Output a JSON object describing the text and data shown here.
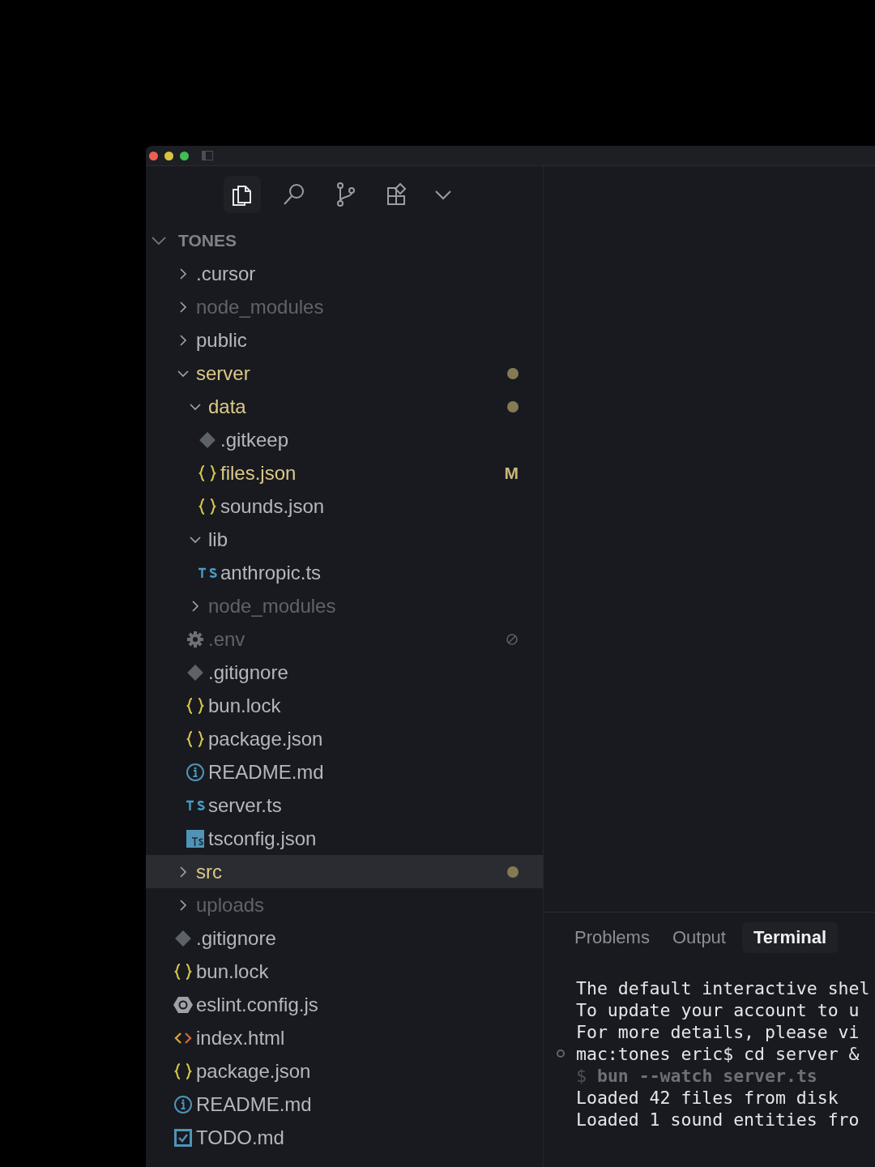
{
  "activity_tabs": [
    {
      "selected": true
    },
    {
      "selected": false
    },
    {
      "selected": false
    },
    {
      "selected": false
    }
  ],
  "explorer": {
    "title": "TONES",
    "expanded": true,
    "tree": [
      {
        "name": ".cursor",
        "kind": "folder",
        "expanded": false,
        "modified": false,
        "ignored": false,
        "selected": false
      },
      {
        "name": "node_modules",
        "kind": "folder",
        "expanded": false,
        "modified": false,
        "ignored": true,
        "selected": false
      },
      {
        "name": "public",
        "kind": "folder",
        "expanded": false,
        "modified": false,
        "ignored": false,
        "selected": false
      },
      {
        "name": "server",
        "kind": "folder",
        "expanded": true,
        "modified": true,
        "ignored": false,
        "selected": false,
        "children": [
          {
            "name": "data",
            "kind": "folder",
            "expanded": true,
            "modified": true,
            "ignored": false,
            "selected": false,
            "children": [
              {
                "name": ".gitkeep",
                "kind": "git",
                "modified": false,
                "ignored": false,
                "selected": false
              },
              {
                "name": "files.json",
                "kind": "json",
                "modified": true,
                "ignored": false,
                "badge": "M",
                "selected": false
              },
              {
                "name": "sounds.json",
                "kind": "json",
                "modified": false,
                "ignored": false,
                "selected": false
              }
            ]
          },
          {
            "name": "lib",
            "kind": "folder",
            "expanded": true,
            "modified": false,
            "ignored": false,
            "selected": false,
            "children": [
              {
                "name": "anthropic.ts",
                "kind": "ts",
                "modified": false,
                "ignored": false,
                "selected": false
              }
            ]
          },
          {
            "name": "node_modules",
            "kind": "folder",
            "expanded": false,
            "modified": false,
            "ignored": true,
            "selected": false
          },
          {
            "name": ".env",
            "kind": "gear",
            "modified": false,
            "ignored": true,
            "selected": false
          },
          {
            "name": ".gitignore",
            "kind": "git",
            "modified": false,
            "ignored": false,
            "selected": false
          },
          {
            "name": "bun.lock",
            "kind": "json",
            "modified": false,
            "ignored": false,
            "selected": false
          },
          {
            "name": "package.json",
            "kind": "json",
            "modified": false,
            "ignored": false,
            "selected": false
          },
          {
            "name": "README.md",
            "kind": "info",
            "modified": false,
            "ignored": false,
            "selected": false
          },
          {
            "name": "server.ts",
            "kind": "ts",
            "modified": false,
            "ignored": false,
            "selected": false
          },
          {
            "name": "tsconfig.json",
            "kind": "tsconfig",
            "modified": false,
            "ignored": false,
            "selected": false
          }
        ]
      },
      {
        "name": "src",
        "kind": "folder",
        "expanded": false,
        "modified": true,
        "ignored": false,
        "selected": true
      },
      {
        "name": "uploads",
        "kind": "folder",
        "expanded": false,
        "modified": false,
        "ignored": true,
        "selected": false
      },
      {
        "name": ".gitignore",
        "kind": "git",
        "modified": false,
        "ignored": false,
        "selected": false
      },
      {
        "name": "bun.lock",
        "kind": "json",
        "modified": false,
        "ignored": false,
        "selected": false
      },
      {
        "name": "eslint.config.js",
        "kind": "eslint",
        "modified": false,
        "ignored": false,
        "selected": false
      },
      {
        "name": "index.html",
        "kind": "html",
        "modified": false,
        "ignored": false,
        "selected": false
      },
      {
        "name": "package.json",
        "kind": "json",
        "modified": false,
        "ignored": false,
        "selected": false
      },
      {
        "name": "README.md",
        "kind": "info",
        "modified": false,
        "ignored": false,
        "selected": false
      },
      {
        "name": "TODO.md",
        "kind": "todo",
        "modified": false,
        "ignored": false,
        "selected": false
      }
    ]
  },
  "panel": {
    "tabs": [
      {
        "label": "Problems",
        "selected": false
      },
      {
        "label": "Output",
        "selected": false
      },
      {
        "label": "Terminal",
        "selected": true
      }
    ],
    "terminal": [
      {
        "kind": "output",
        "text": "The default interactive shel"
      },
      {
        "kind": "output",
        "text": "To update your account to u"
      },
      {
        "kind": "output",
        "text": "For more details, please vi"
      },
      {
        "kind": "prompt",
        "text": "mac:tones eric$ cd server &"
      },
      {
        "kind": "command",
        "prompt": "$",
        "text": "bun --watch server.ts"
      },
      {
        "kind": "output",
        "text": "Loaded 42 files from disk"
      },
      {
        "kind": "output",
        "text": "Loaded 1 sound entities fro"
      }
    ]
  }
}
